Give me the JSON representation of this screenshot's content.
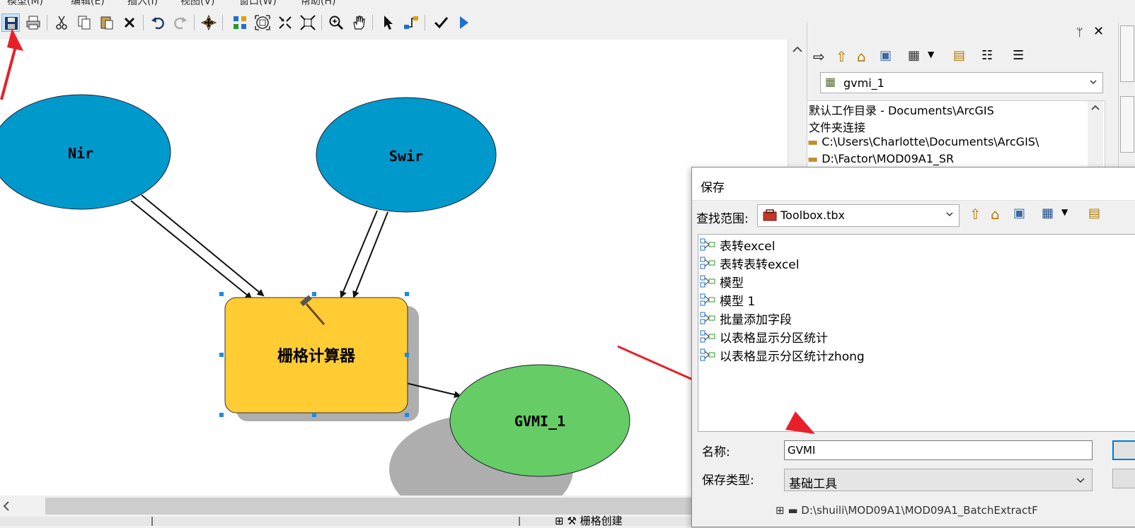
{
  "menu": {
    "items": [
      "模型(M)",
      "编辑(E)",
      "插入(I)",
      "视图(V)",
      "窗口(W)",
      "帮助(H)"
    ]
  },
  "toolbar": {
    "buttons": [
      "save-icon",
      "print-icon",
      "cut-icon",
      "copy-icon",
      "paste-icon",
      "delete-icon",
      "undo-icon",
      "redo-icon",
      "add-data-icon",
      "auto-layout-icon",
      "full-extent-icon",
      "zoom-in-fixed-icon",
      "zoom-out-fixed-icon",
      "zoom-icon",
      "pan-icon",
      "select-icon",
      "connect-icon",
      "validate-icon",
      "run-icon"
    ]
  },
  "model": {
    "nodes": {
      "nir": "Nir",
      "swir": "Swir",
      "tool": "栅格计算器",
      "output": "GVMI_1"
    },
    "colors": {
      "input": "#0099cc",
      "tool": "#ffcc33",
      "output": "#66cc66",
      "arrow": "#e8202a"
    }
  },
  "catalog": {
    "location_value": "gvmi_1",
    "tree": [
      "默认工作目录 - Documents\\ArcGIS",
      "文件夹连接",
      "C:\\Users\\Charlotte\\Documents\\ArcGIS\\",
      "D:\\Factor\\MOD09A1_SR"
    ],
    "bottom_item": "栅格创建",
    "bottom_right_item": "D:\\shuili\\MOD09A1\\MOD09A1_BatchExtractF"
  },
  "save_dialog": {
    "title": "保存",
    "look_in_label": "查找范围:",
    "look_in_value": "Toolbox.tbx",
    "files": [
      "表转excel",
      "表转表转excel",
      "模型",
      "模型 1",
      "批量添加字段",
      "以表格显示分区统计",
      "以表格显示分区统计zhong"
    ],
    "name_label": "名称:",
    "name_value": "GVMI",
    "type_label": "保存类型:",
    "type_value": "基础工具"
  }
}
